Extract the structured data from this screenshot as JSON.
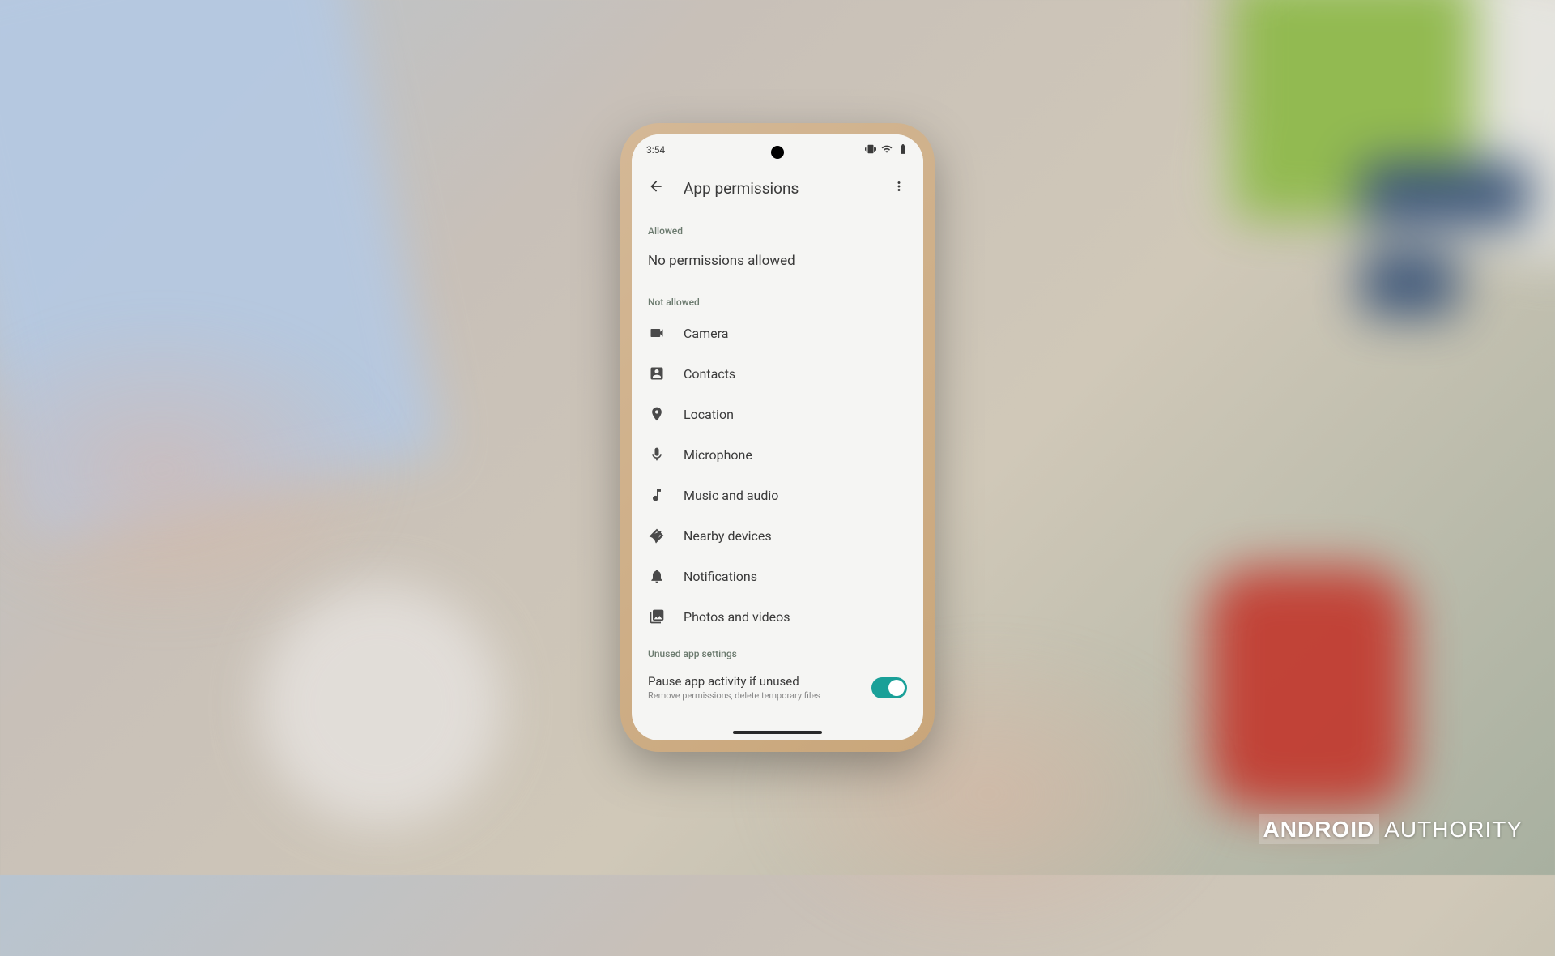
{
  "statusBar": {
    "time": "3:54"
  },
  "appBar": {
    "title": "App permissions"
  },
  "sections": {
    "allowed": {
      "header": "Allowed",
      "emptyMessage": "No permissions allowed"
    },
    "notAllowed": {
      "header": "Not allowed",
      "items": [
        {
          "id": "camera",
          "label": "Camera"
        },
        {
          "id": "contacts",
          "label": "Contacts"
        },
        {
          "id": "location",
          "label": "Location"
        },
        {
          "id": "microphone",
          "label": "Microphone"
        },
        {
          "id": "music",
          "label": "Music and audio"
        },
        {
          "id": "nearby",
          "label": "Nearby devices"
        },
        {
          "id": "notifications",
          "label": "Notifications"
        },
        {
          "id": "photos",
          "label": "Photos and videos"
        }
      ]
    },
    "unused": {
      "header": "Unused app settings",
      "toggle": {
        "title": "Pause app activity if unused",
        "subtitle": "Remove permissions, delete temporary files",
        "state": true
      }
    }
  },
  "watermark": {
    "bold": "ANDROID",
    "light": "AUTHORITY"
  }
}
